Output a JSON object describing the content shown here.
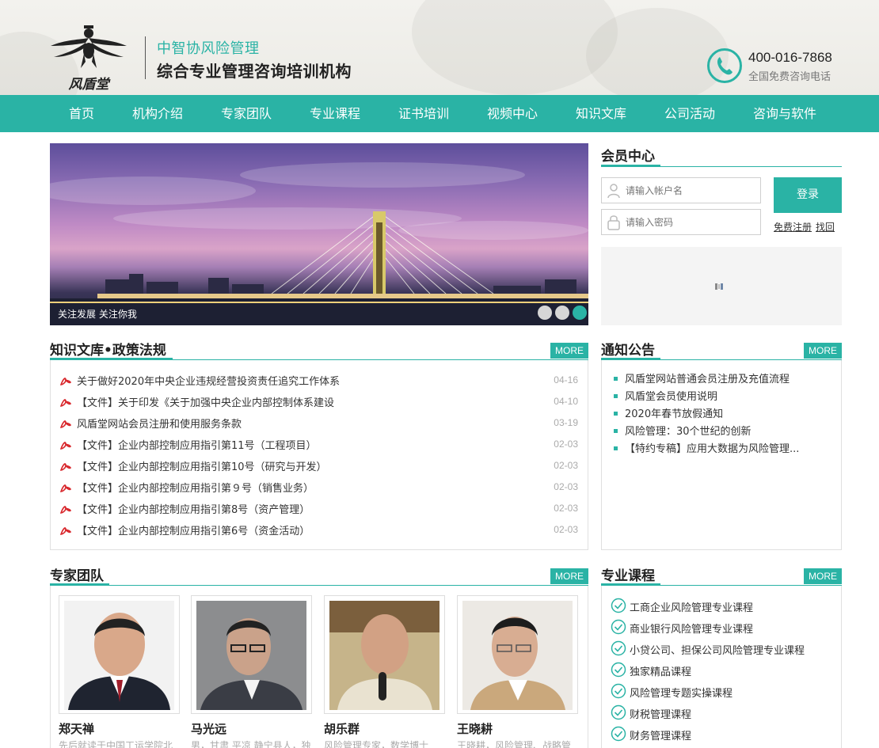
{
  "header": {
    "logo_text": "风盾堂",
    "brand_sub": "中智协风险管理",
    "brand_main": "综合专业管理咨询培训机构",
    "phone_number": "400-016-7868",
    "phone_caption": "全国免费咨询电话"
  },
  "nav": {
    "items": [
      {
        "label": "首页"
      },
      {
        "label": "机构介绍"
      },
      {
        "label": "专家团队"
      },
      {
        "label": "专业课程"
      },
      {
        "label": "证书培训"
      },
      {
        "label": "视频中心"
      },
      {
        "label": "知识文库"
      },
      {
        "label": "公司活动"
      },
      {
        "label": "咨询与软件"
      }
    ]
  },
  "banner": {
    "caption": "关注发展 关注你我",
    "active_slide": 3
  },
  "member": {
    "title": "会员中心",
    "account_placeholder": "请输入帐户名",
    "password_placeholder": "请输入密码",
    "login_label": "登录",
    "register_label": "免费注册",
    "recover_label": "找回"
  },
  "knowledge": {
    "title": "知识文库•政策法规",
    "more": "MORE",
    "items": [
      {
        "title": "关于做好2020年中央企业违规经营投资责任追究工作体系",
        "date": "04-16"
      },
      {
        "title": "【文件】关于印发《关于加强中央企业内部控制体系建设",
        "date": "04-10"
      },
      {
        "title": "风盾堂网站会员注册和使用服务条款",
        "date": "03-19"
      },
      {
        "title": "【文件】企业内部控制应用指引第11号（工程项目）",
        "date": "02-03"
      },
      {
        "title": "【文件】企业内部控制应用指引第10号（研究与开发）",
        "date": "02-03"
      },
      {
        "title": "【文件】企业内部控制应用指引第９号（销售业务）",
        "date": "02-03"
      },
      {
        "title": "【文件】企业内部控制应用指引第8号（资产管理）",
        "date": "02-03"
      },
      {
        "title": "【文件】企业内部控制应用指引第6号（资金活动）",
        "date": "02-03"
      }
    ]
  },
  "notice": {
    "title": "通知公告",
    "more": "MORE",
    "items": [
      {
        "title": "风盾堂网站普通会员注册及充值流程"
      },
      {
        "title": "风盾堂会员使用说明"
      },
      {
        "title": "2020年春节放假通知"
      },
      {
        "title": "风险管理：30个世纪的创新"
      },
      {
        "title": "【特约专稿】应用大数据为风险管理..."
      }
    ]
  },
  "experts": {
    "title": "专家团队",
    "more": "MORE",
    "items": [
      {
        "name": "郑天禅",
        "desc": "先后就读于中国工运学院北"
      },
      {
        "name": "马光远",
        "desc": "男，甘肃 平凉 静宁县人，独"
      },
      {
        "name": "胡乐群",
        "desc": "风险管理专家，数学博士"
      },
      {
        "name": "王晓耕",
        "desc": "王晓耕，风险管理、战略管"
      }
    ]
  },
  "courses": {
    "title": "专业课程",
    "more": "MORE",
    "items": [
      {
        "title": "工商企业风险管理专业课程"
      },
      {
        "title": "商业银行风险管理专业课程"
      },
      {
        "title": "小贷公司、担保公司风险管理专业课程"
      },
      {
        "title": "独家精品课程"
      },
      {
        "title": "风险管理专题实操课程"
      },
      {
        "title": "财税管理课程"
      },
      {
        "title": "财务管理课程"
      }
    ]
  },
  "colors": {
    "accent": "#2ab3a5",
    "pdf_red": "#d8262b"
  }
}
